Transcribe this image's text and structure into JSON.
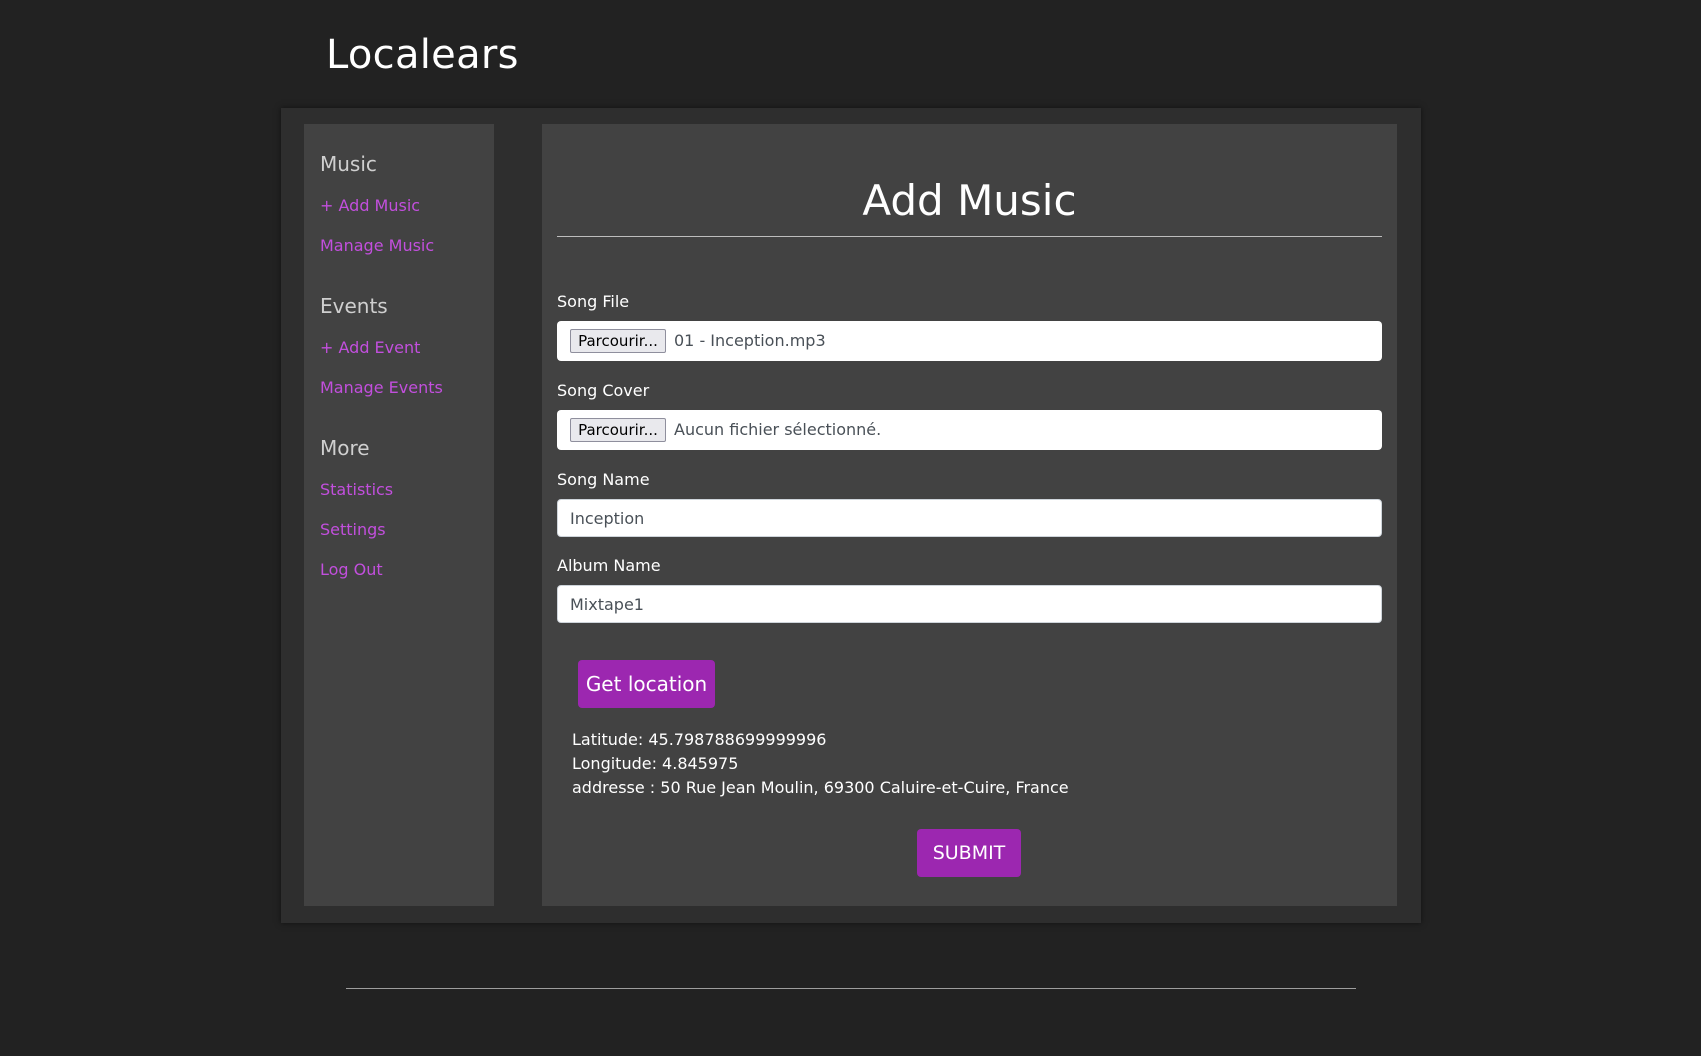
{
  "app": {
    "brand": "Localears"
  },
  "sidebar": {
    "groups": [
      {
        "heading": "Music",
        "links": [
          "+ Add Music",
          "Manage Music"
        ]
      },
      {
        "heading": "Events",
        "links": [
          "+ Add Event",
          "Manage Events"
        ]
      },
      {
        "heading": "More",
        "links": [
          "Statistics",
          "Settings",
          "Log Out"
        ]
      }
    ]
  },
  "form": {
    "title": "Add Music",
    "song_file": {
      "label": "Song File",
      "button": "Parcourir...",
      "value": "01 - Inception.mp3"
    },
    "song_cover": {
      "label": "Song Cover",
      "button": "Parcourir...",
      "value": "Aucun fichier sélectionné."
    },
    "song_name": {
      "label": "Song Name",
      "value": "Inception"
    },
    "album_name": {
      "label": "Album Name",
      "value": "Mixtape1"
    },
    "location_button": "Get location",
    "latitude": "Latitude: 45.798788699999996",
    "longitude": "Longitude: 4.845975",
    "address": "addresse : 50 Rue Jean Moulin, 69300 Caluire-et-Cuire, France",
    "submit": "SUBMIT"
  },
  "colors": {
    "background": "#222222",
    "panel": "#2e2e2e",
    "card": "#424242",
    "accent": "#9c27b0",
    "link": "#c24fdd"
  }
}
